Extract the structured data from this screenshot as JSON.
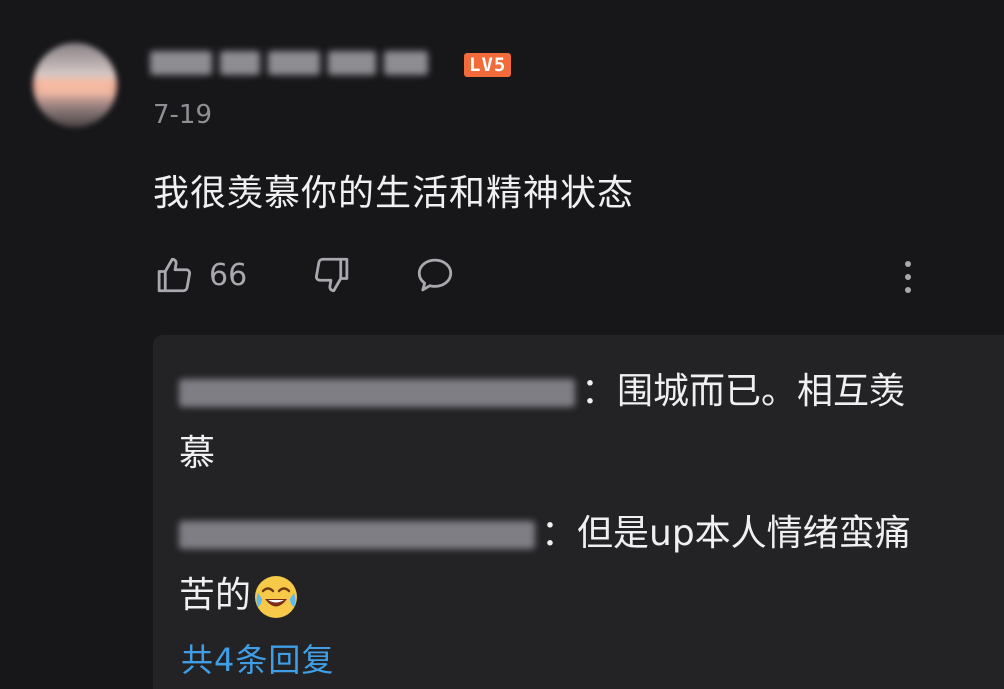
{
  "comment": {
    "date": "7-19",
    "level_badge": "LV5",
    "text": "我很羡慕你的生活和精神状态",
    "like_count": "66"
  },
  "replies": [
    {
      "text_line1": "：围城而已。相互羡",
      "text_line2": "慕"
    },
    {
      "text_line1": "：但是up本人情绪蛮痛",
      "text_line2": "苦的"
    }
  ],
  "more_replies_label": "共4条回复",
  "colors": {
    "background": "#17171a",
    "panel": "#232326",
    "level_badge": "#f26b3a",
    "link": "#3f9ee6",
    "muted": "#8e8e94"
  },
  "icons": [
    "like-icon",
    "dislike-icon",
    "reply-icon",
    "more-vertical-icon",
    "laughing-crying-emoji"
  ]
}
